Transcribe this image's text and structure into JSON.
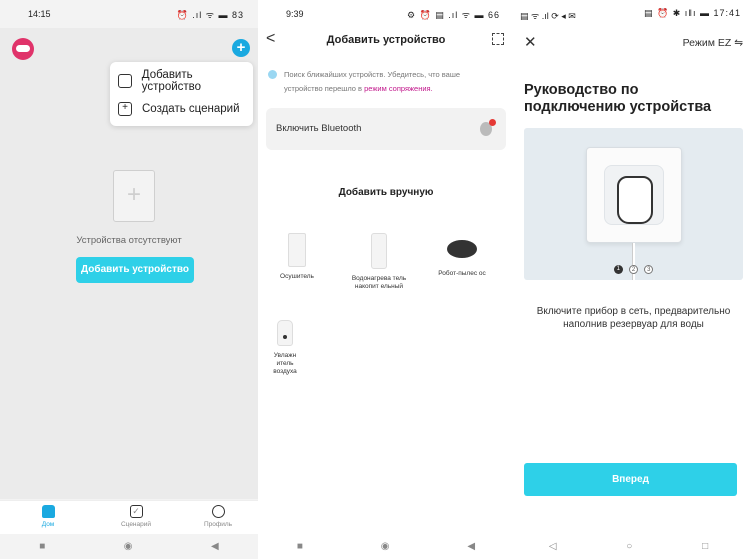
{
  "panel1": {
    "status": {
      "time": "14:15",
      "icons": "⏰ .ıl ᯤ ▬ 83"
    },
    "menu": {
      "add_device": "Добавить устройство",
      "create_scenario": "Создать сценарий"
    },
    "empty_text": "Устройства отсутствуют",
    "add_button": "Добавить устройство",
    "tabs": [
      {
        "label": "Дом"
      },
      {
        "label": "Сценарий"
      },
      {
        "label": "Профиль"
      }
    ]
  },
  "panel2": {
    "status": {
      "time": "9:39",
      "icons": "⚙ ⏰ ▤ .ıl ᯤ ▬ 66"
    },
    "title": "Добавить устройство",
    "hint": "Поиск ближайших устройств. Убедитесь, что ваше устройство перешло в ",
    "hint_link": "режим сопряжения.",
    "bluetooth_label": "Включить Bluetooth",
    "manual_title": "Добавить вручную",
    "devices": [
      {
        "name": "Осушитель"
      },
      {
        "name": "Водонагрева тель накопит ельный"
      },
      {
        "name": "Робот-пылес ос"
      },
      {
        "name": "Увлажн итель воздуха"
      }
    ]
  },
  "panel3": {
    "status": {
      "left": "▤ ᯤ .ıl ⟳ ◂ ✉",
      "right": "▤ ⏰ ✱ ıǁı ▬ 17:41"
    },
    "mode": "Режим EZ ⇋",
    "title": "Руководство по подключению устройства",
    "step_dots": [
      "1",
      "2",
      "3"
    ],
    "description": "Включите прибор в сеть, предварительно наполнив резервуар для воды",
    "next_button": "Вперед"
  },
  "colors": {
    "accent": "#1aa9e0",
    "button": "#2ed0e8",
    "link": "#c2188c"
  }
}
